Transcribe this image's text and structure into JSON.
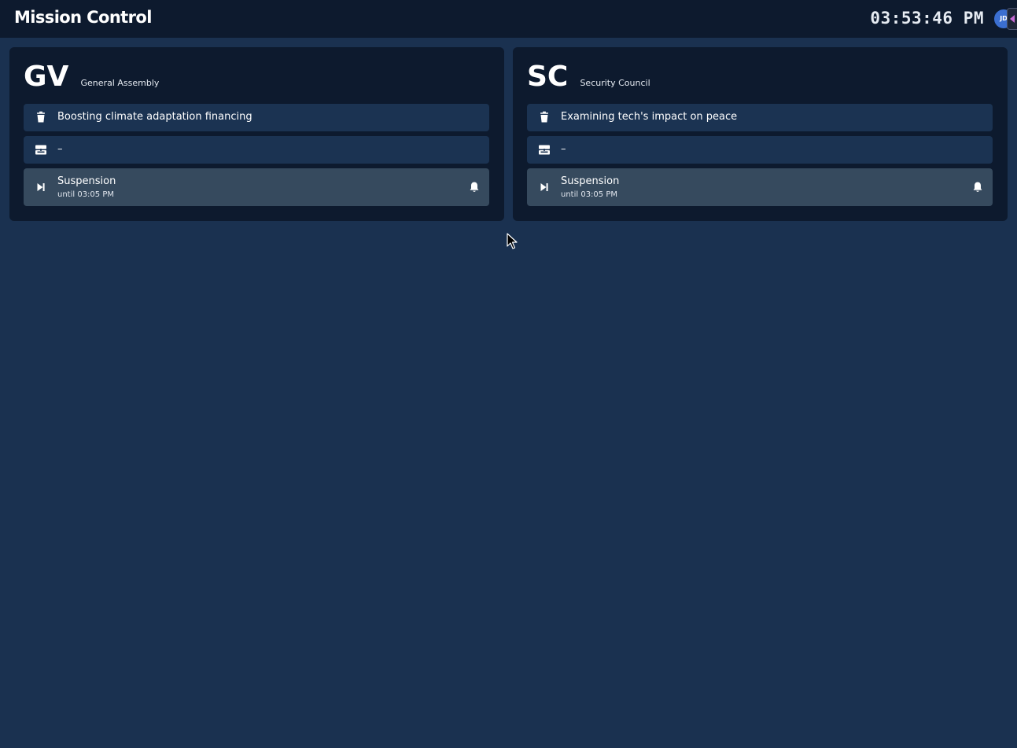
{
  "header": {
    "title": "Mission Control",
    "clock": "03:53:46 PM",
    "avatar_initials": "JD"
  },
  "bodies": [
    {
      "code": "GV",
      "name": "General Assembly",
      "topic": "Boosting climate adaptation financing",
      "speaker": "–",
      "status": "Suspension",
      "status_detail": "until 03:05 PM"
    },
    {
      "code": "SC",
      "name": "Security Council",
      "topic": "Examining tech's impact on peace",
      "speaker": "–",
      "status": "Suspension",
      "status_detail": "until 03:05 PM"
    }
  ],
  "icons": {
    "topic": "cup-icon",
    "speaker": "podium-icon",
    "status": "skip-forward-icon",
    "alert": "bell-icon",
    "toggle": "caret-left-icon"
  },
  "colors": {
    "page_background": "#1a3150",
    "topbar_background": "#0d1a2e",
    "card_background": "#0d1a2e",
    "row_background": "#1b3352",
    "status_row_background": "#364a5e",
    "avatar": "#3b6fd1",
    "toggle_accent": "#c86bd6"
  }
}
